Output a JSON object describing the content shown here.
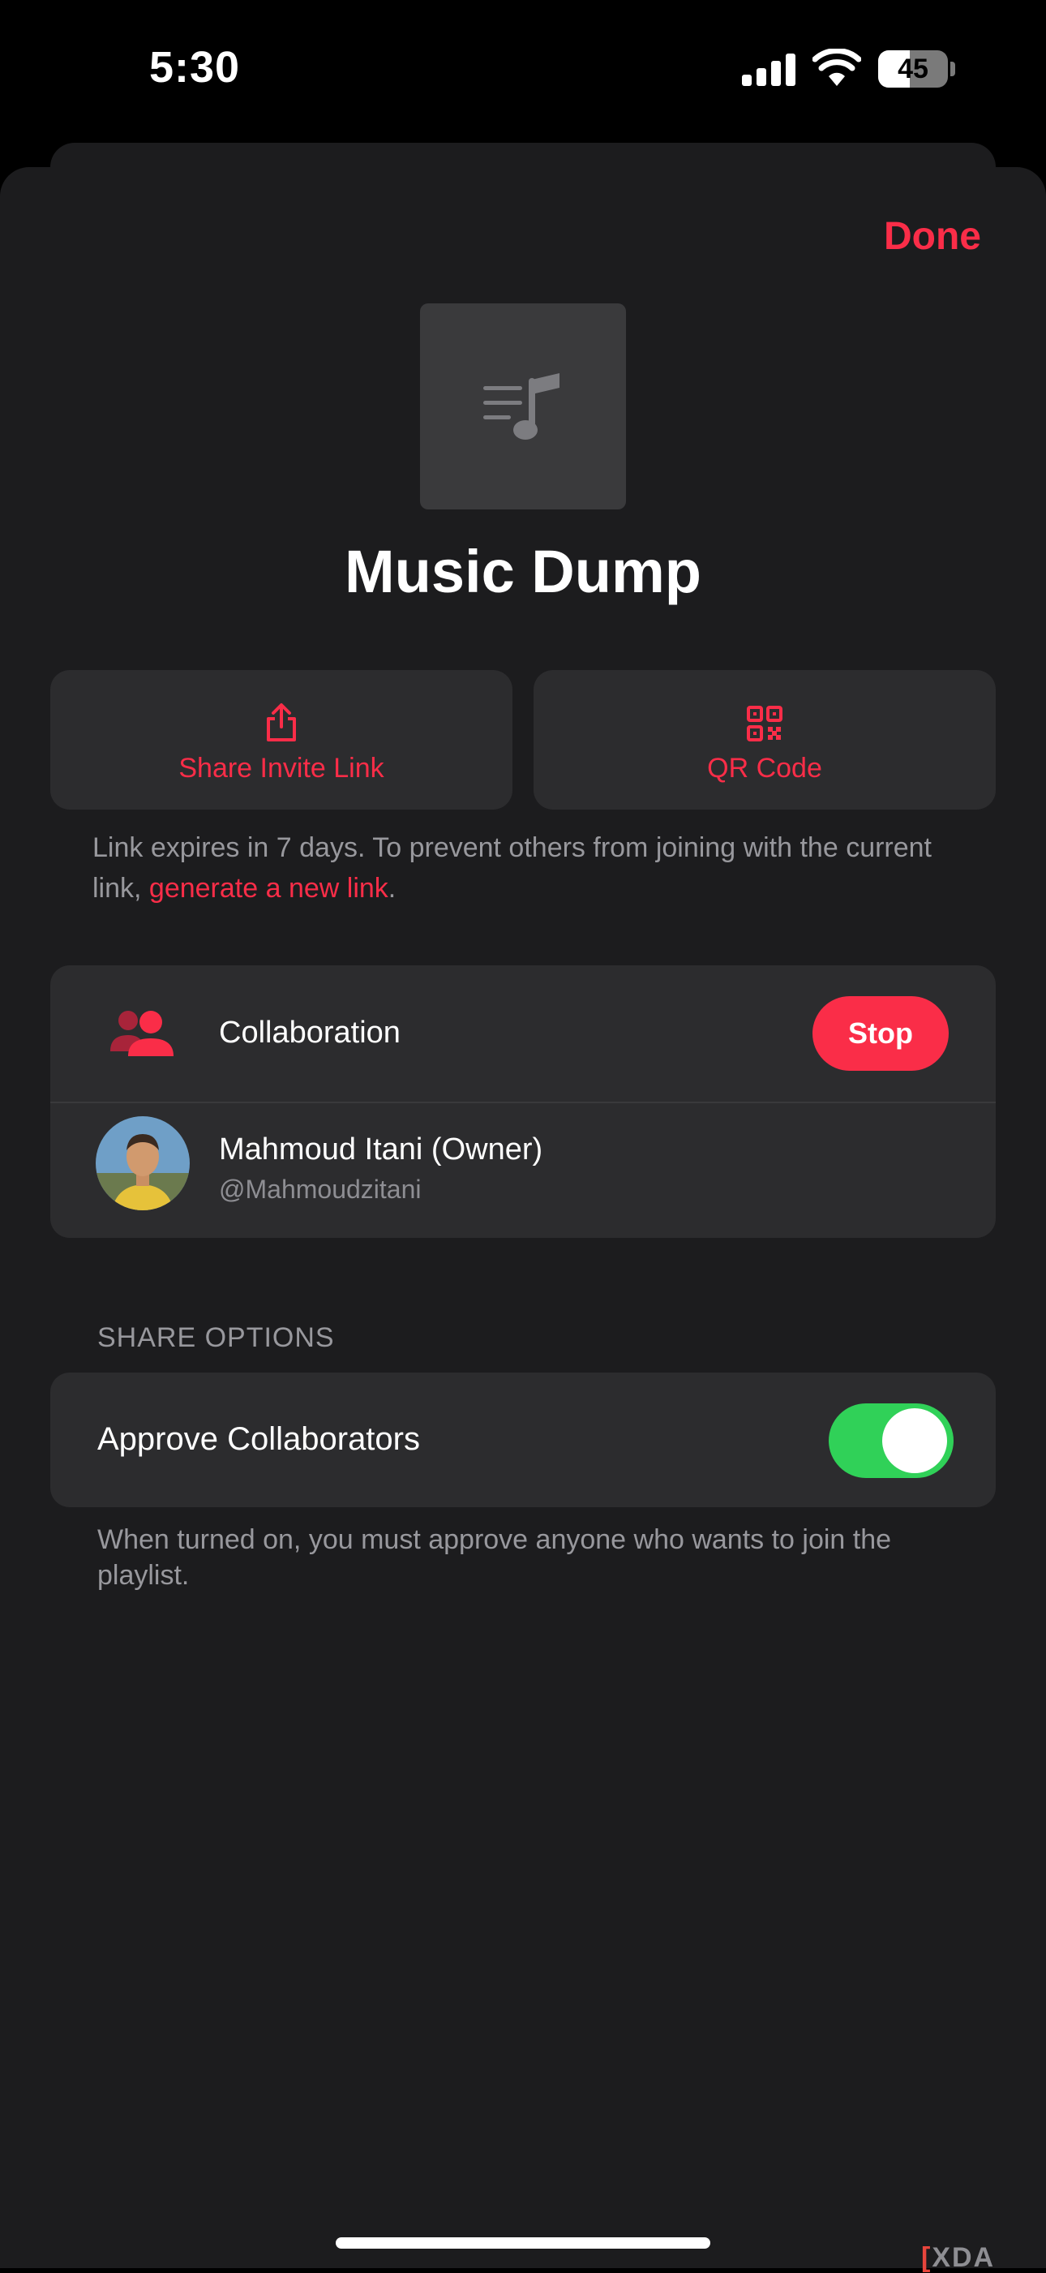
{
  "status_bar": {
    "time": "5:30",
    "battery_level": "45",
    "battery_fraction": 0.45,
    "signal_icon": "cellular-signal-icon",
    "wifi_icon": "wifi-icon"
  },
  "header": {
    "done_label": "Done"
  },
  "playlist": {
    "artwork_icon": "music-note-list-icon",
    "title": "Music Dump"
  },
  "actions": {
    "share_label": "Share Invite Link",
    "share_icon": "share-icon",
    "qr_label": "QR Code",
    "qr_icon": "qr-code-icon"
  },
  "link_note": {
    "text": "Link expires in 7 days. To prevent others from joining with the current link, ",
    "link_text": "generate a new link",
    "suffix": "."
  },
  "collaboration": {
    "icon": "people-icon",
    "label": "Collaboration",
    "stop_label": "Stop",
    "owner": {
      "name": "Mahmoud Itani (Owner)",
      "handle": "@Mahmoudzitani"
    }
  },
  "share_options": {
    "header": "SHARE OPTIONS",
    "approve_label": "Approve Collaborators",
    "approve_enabled": true,
    "footer": "When turned on, you must approve anyone who wants to join the playlist."
  },
  "watermark": {
    "bracket": "[",
    "brand": "XDA"
  },
  "colors": {
    "accent": "#fa2d48",
    "toggle_on": "#30d158",
    "background": "#1c1c1e",
    "card": "#2c2c2e"
  }
}
